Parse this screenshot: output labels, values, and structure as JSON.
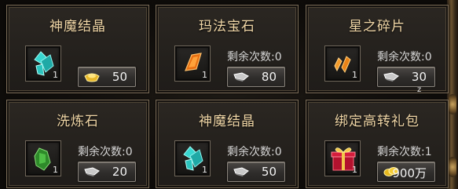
{
  "cards": [
    {
      "title": "神魔结晶",
      "icon": "crystal-icon",
      "qty": "1",
      "remain": "",
      "currency": "gold-ingot-icon",
      "price": "50"
    },
    {
      "title": "玛法宝石",
      "icon": "orange-gem-icon",
      "qty": "1",
      "remain": "剩余次数:0",
      "currency": "silver-ingot-icon",
      "price": "80"
    },
    {
      "title": "星之碎片",
      "icon": "star-shard-icon",
      "qty": "1",
      "remain": "剩余次数:0",
      "currency": "silver-ingot-icon",
      "price": "30"
    },
    {
      "title": "洗炼石",
      "icon": "green-stone-icon",
      "qty": "1",
      "remain": "剩余次数:0",
      "currency": "silver-ingot-icon",
      "price": "20"
    },
    {
      "title": "神魔结晶",
      "icon": "crystal-icon",
      "qty": "1",
      "remain": "剩余次数:0",
      "currency": "silver-ingot-icon",
      "price": "50"
    },
    {
      "title": "绑定高转礼包",
      "icon": "gift-box-icon",
      "qty": "1",
      "remain": "剩余次数:1",
      "currency": "gold-coin-icon",
      "price": "900万"
    }
  ],
  "stray_text": "z",
  "colors": {
    "title": "#f0d6a6",
    "border": "#7c6d58",
    "background": "#0f0d0b"
  }
}
